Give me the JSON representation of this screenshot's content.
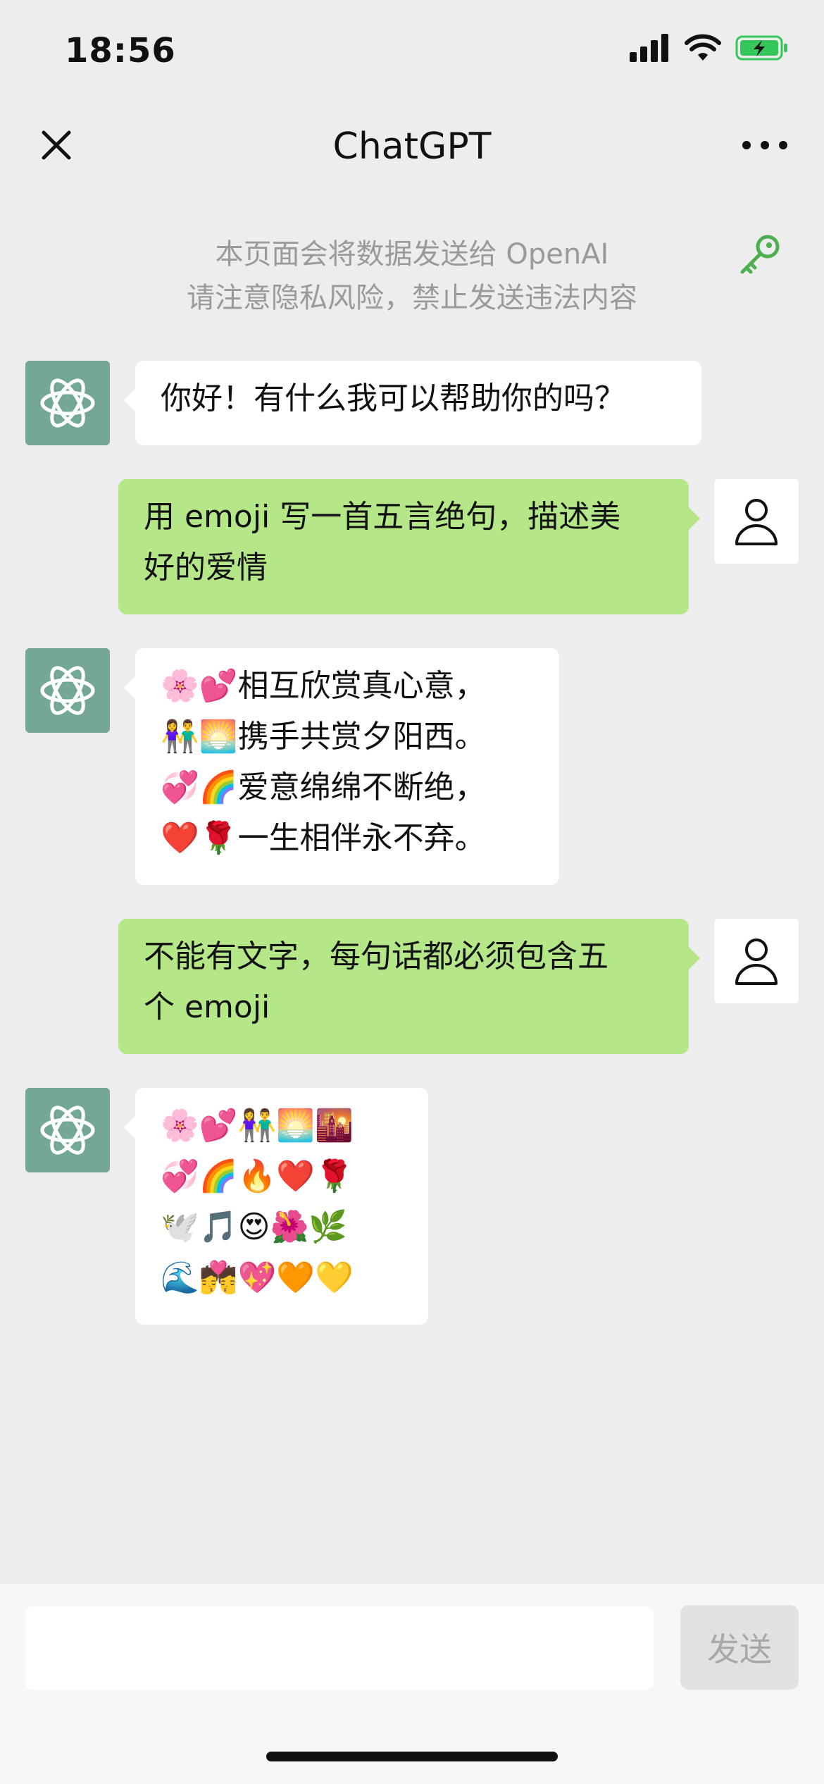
{
  "status": {
    "time": "18:56"
  },
  "header": {
    "title": "ChatGPT"
  },
  "notice": {
    "line1": "本页面会将数据发送给 OpenAI",
    "line2": "请注意隐私风险，禁止发送违法内容"
  },
  "messages": [
    {
      "role": "bot",
      "lines": [
        "你好！有什么我可以帮助你的吗？"
      ]
    },
    {
      "role": "user",
      "lines": [
        "用 emoji 写一首五言绝句，描述美",
        "好的爱情"
      ]
    },
    {
      "role": "bot",
      "lines": [
        "🌸💕相互欣赏真心意，",
        "👫🌅携手共赏夕阳西。",
        "💞🌈爱意绵绵不断绝，",
        "❤️🌹一生相伴永不弃。"
      ]
    },
    {
      "role": "user",
      "lines": [
        "不能有文字，每句话都必须包含五",
        "个 emoji"
      ]
    },
    {
      "role": "bot",
      "lines": [
        "🌸💕👫🌅🌇",
        "💞🌈🔥❤️🌹",
        "🕊️🎵😍🌺🌿",
        "🌊💏💖🧡💛"
      ]
    }
  ],
  "input": {
    "placeholder": "",
    "value": ""
  },
  "send": {
    "label": "发送"
  },
  "colors": {
    "bg": "#EDEDED",
    "user_bubble": "#B5E789",
    "bot_avatar": "#74A895",
    "send_disabled": "#E1E1E1"
  }
}
